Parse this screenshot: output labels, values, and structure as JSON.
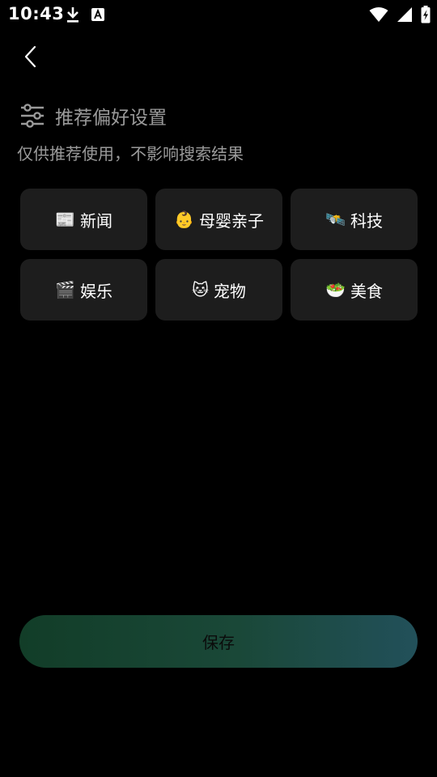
{
  "status_bar": {
    "time": "10:43",
    "icons": [
      "download-icon",
      "a-notification-icon",
      "wifi-icon",
      "signal-icon",
      "battery-charging-icon"
    ]
  },
  "nav": {
    "back_icon": "chevron-left-icon"
  },
  "header": {
    "icon": "sliders-icon",
    "title": "推荐偏好设置",
    "subtitle": "仅供推荐使用，不影响搜索结果"
  },
  "categories": [
    {
      "emoji": "📰",
      "label": "新闻"
    },
    {
      "emoji": "👶",
      "label": "母婴亲子"
    },
    {
      "emoji": "🛰️",
      "label": "科技"
    },
    {
      "emoji": "🎬",
      "label": "娱乐"
    },
    {
      "emoji": "🐱",
      "label": "宠物"
    },
    {
      "emoji": "🥗",
      "label": "美食"
    }
  ],
  "actions": {
    "save_label": "保存"
  },
  "colors": {
    "background": "#000000",
    "card": "#1d1d1d",
    "muted_text": "#9a9a9a",
    "save_gradient_start": "#123d28",
    "save_gradient_end": "#22505a"
  }
}
